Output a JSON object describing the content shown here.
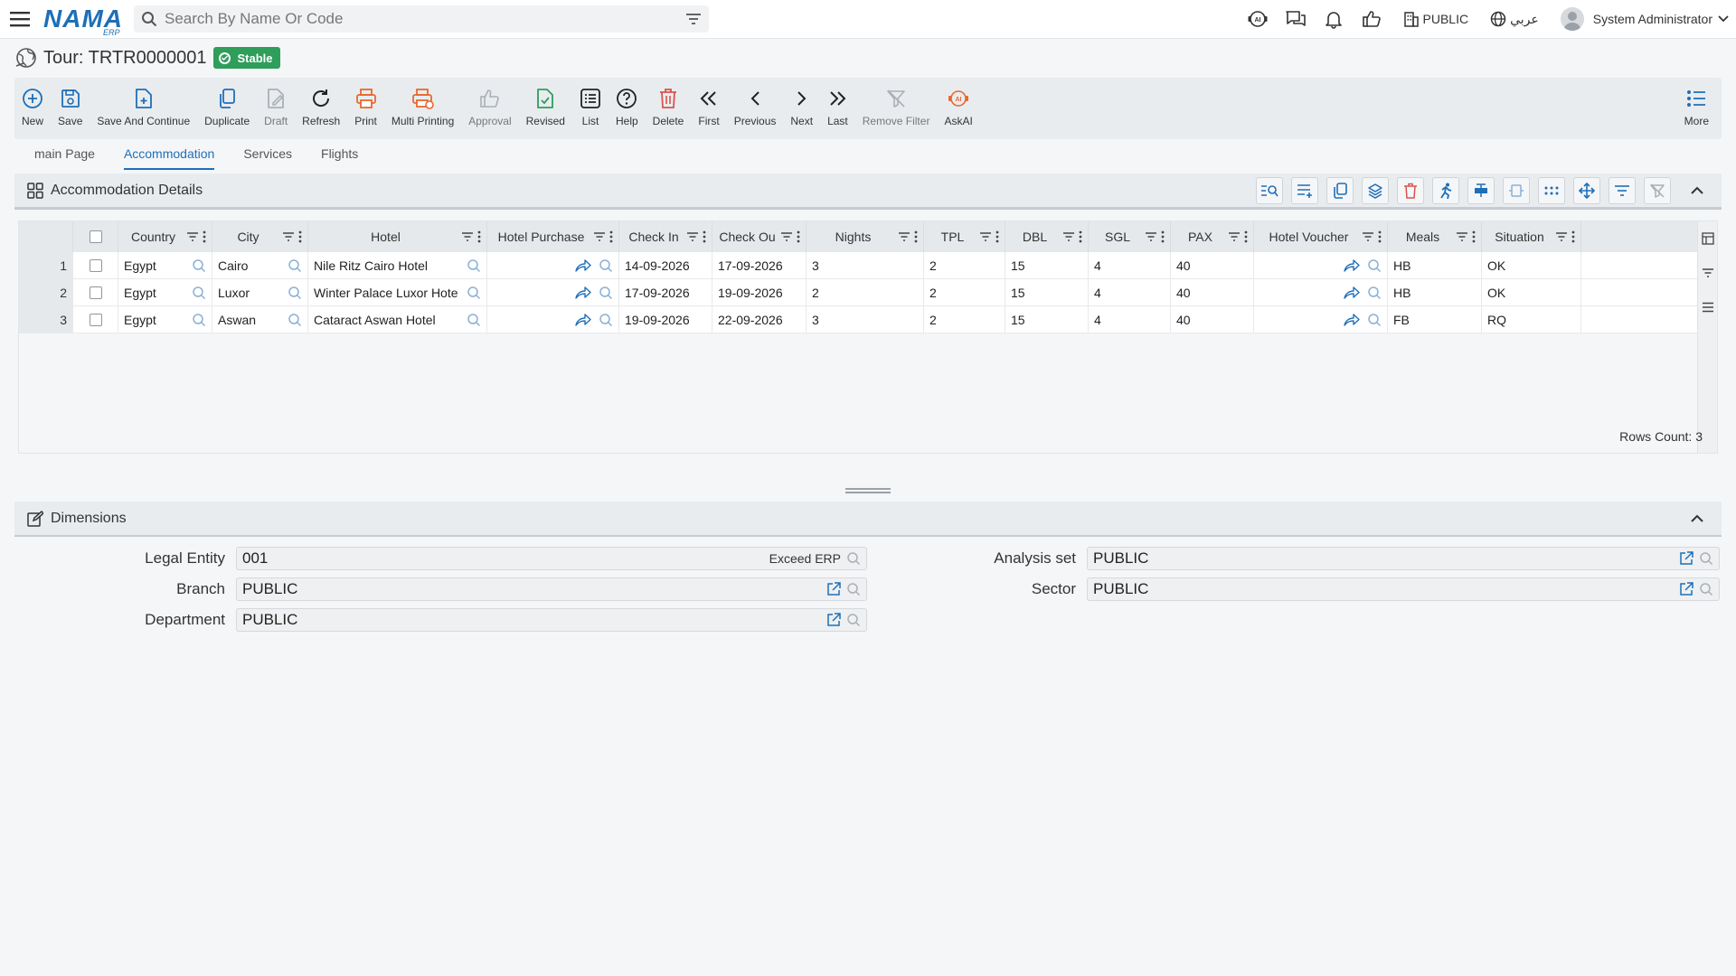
{
  "topbar": {
    "logo": "NAMA",
    "logo_sub": "ERP",
    "search_placeholder": "Search By Name Or Code",
    "org": "PUBLIC",
    "language": "عربي",
    "user": "System Administrator"
  },
  "header": {
    "title": "Tour: TRTR0000001",
    "status": "Stable"
  },
  "toolbar": {
    "new": "New",
    "save": "Save",
    "save_continue": "Save And Continue",
    "duplicate": "Duplicate",
    "draft": "Draft",
    "refresh": "Refresh",
    "print": "Print",
    "multi_printing": "Multi Printing",
    "approval": "Approval",
    "revised": "Revised",
    "list": "List",
    "help": "Help",
    "delete": "Delete",
    "first": "First",
    "previous": "Previous",
    "next": "Next",
    "last": "Last",
    "remove_filter": "Remove Filter",
    "askai": "AskAI",
    "more": "More"
  },
  "tabs": [
    "main Page",
    "Accommodation",
    "Services",
    "Flights"
  ],
  "accommodation": {
    "title": "Accommodation Details",
    "columns": [
      "Country",
      "City",
      "Hotel",
      "Hotel Purchase",
      "Check In",
      "Check Ou",
      "Nights",
      "TPL",
      "DBL",
      "SGL",
      "PAX",
      "Hotel Voucher",
      "Meals",
      "Situation"
    ],
    "rows": [
      {
        "n": "1",
        "country": "Egypt",
        "city": "Cairo",
        "hotel": "Nile Ritz Cairo Hotel",
        "check_in": "14-09-2026",
        "check_out": "17-09-2026",
        "nights": "3",
        "tpl": "2",
        "dbl": "15",
        "sgl": "4",
        "pax": "40",
        "meals": "HB",
        "situation": "OK"
      },
      {
        "n": "2",
        "country": "Egypt",
        "city": "Luxor",
        "hotel": "Winter Palace Luxor Hote",
        "check_in": "17-09-2026",
        "check_out": "19-09-2026",
        "nights": "2",
        "tpl": "2",
        "dbl": "15",
        "sgl": "4",
        "pax": "40",
        "meals": "HB",
        "situation": "OK"
      },
      {
        "n": "3",
        "country": "Egypt",
        "city": "Aswan",
        "hotel": "Cataract Aswan Hotel",
        "check_in": "19-09-2026",
        "check_out": "22-09-2026",
        "nights": "3",
        "tpl": "2",
        "dbl": "15",
        "sgl": "4",
        "pax": "40",
        "meals": "FB",
        "situation": "RQ"
      }
    ],
    "rows_count": "Rows Count: 3"
  },
  "dimensions": {
    "title": "Dimensions",
    "legal_entity_label": "Legal Entity",
    "legal_entity_value": "001",
    "legal_entity_tag": "Exceed ERP",
    "branch_label": "Branch",
    "branch_value": "PUBLIC",
    "department_label": "Department",
    "department_value": "PUBLIC",
    "analysis_set_label": "Analysis set",
    "analysis_set_value": "PUBLIC",
    "sector_label": "Sector",
    "sector_value": "PUBLIC"
  },
  "colors": {
    "accent": "#1e6fb8",
    "success": "#2e9e5a",
    "danger": "#d9534f",
    "print": "#e8692e"
  }
}
